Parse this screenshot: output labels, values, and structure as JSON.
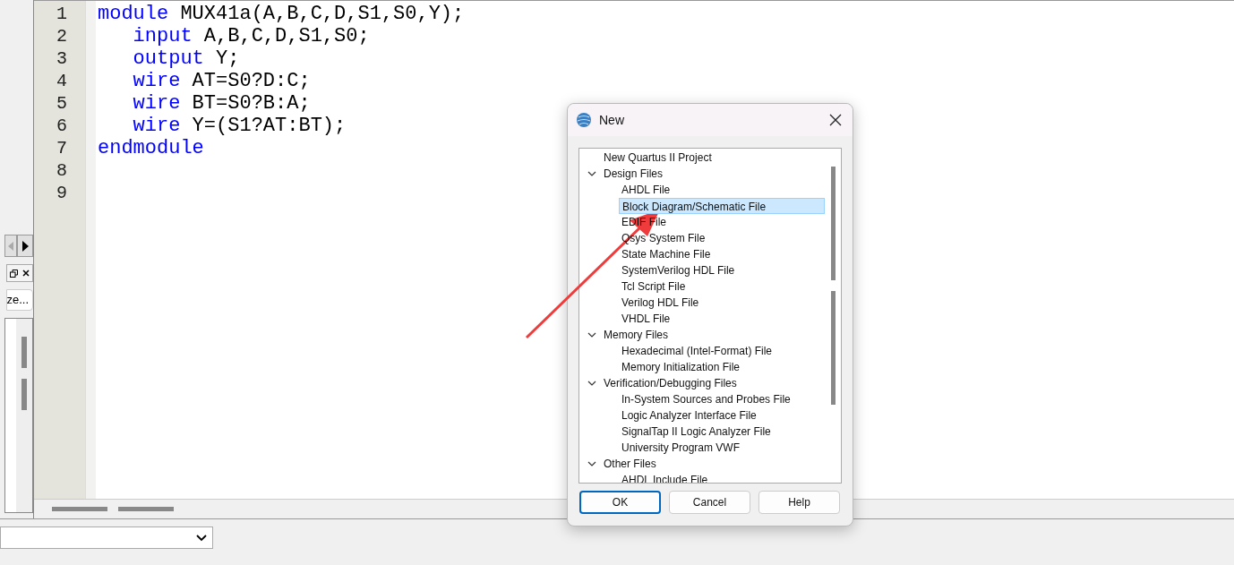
{
  "side_panel": {
    "button_text": "ze..."
  },
  "editor": {
    "lines": [
      {
        "number": "1",
        "tokens": [
          {
            "text": "module",
            "kind": "keyword"
          },
          {
            "text": " MUX41a(A,B,C,D,S1,S0,Y);",
            "kind": "plain"
          }
        ]
      },
      {
        "number": "2",
        "tokens": [
          {
            "text": "   input",
            "kind": "keyword"
          },
          {
            "text": " A,B,C,D,S1,S0;",
            "kind": "plain"
          }
        ]
      },
      {
        "number": "3",
        "tokens": [
          {
            "text": "   output",
            "kind": "keyword"
          },
          {
            "text": " Y;",
            "kind": "plain"
          }
        ]
      },
      {
        "number": "4",
        "tokens": [
          {
            "text": "   wire",
            "kind": "keyword"
          },
          {
            "text": " AT=S0?D:C;",
            "kind": "plain"
          }
        ]
      },
      {
        "number": "5",
        "tokens": [
          {
            "text": "   wire",
            "kind": "keyword"
          },
          {
            "text": " BT=S0?B:A;",
            "kind": "plain"
          }
        ]
      },
      {
        "number": "6",
        "tokens": [
          {
            "text": "   wire",
            "kind": "keyword"
          },
          {
            "text": " Y=(S1?AT:BT);",
            "kind": "plain"
          }
        ]
      },
      {
        "number": "7",
        "tokens": [
          {
            "text": "endmodule",
            "kind": "keyword"
          }
        ]
      },
      {
        "number": "8"
      },
      {
        "number": "9"
      }
    ]
  },
  "dialog": {
    "title": "New",
    "items": [
      {
        "label": "New Quartus II Project",
        "selected": false
      },
      {
        "label": "Design Files",
        "expanded": true,
        "selected": false,
        "children": [
          {
            "label": "AHDL File",
            "selected": false
          },
          {
            "label": "Block Diagram/Schematic File",
            "selected": true
          },
          {
            "label": "EDIF File",
            "selected": false
          },
          {
            "label": "Qsys System File",
            "selected": false
          },
          {
            "label": "State Machine File",
            "selected": false
          },
          {
            "label": "SystemVerilog HDL File",
            "selected": false
          },
          {
            "label": "Tcl Script File",
            "selected": false
          },
          {
            "label": "Verilog HDL File",
            "selected": false
          },
          {
            "label": "VHDL File",
            "selected": false
          }
        ]
      },
      {
        "label": "Memory Files",
        "expanded": true,
        "selected": false,
        "children": [
          {
            "label": "Hexadecimal (Intel-Format) File",
            "selected": false
          },
          {
            "label": "Memory Initialization File",
            "selected": false
          }
        ]
      },
      {
        "label": "Verification/Debugging Files",
        "expanded": true,
        "selected": false,
        "children": [
          {
            "label": "In-System Sources and Probes File",
            "selected": false
          },
          {
            "label": "Logic Analyzer Interface File",
            "selected": false
          },
          {
            "label": "SignalTap II Logic Analyzer File",
            "selected": false
          },
          {
            "label": "University Program VWF",
            "selected": false
          }
        ]
      },
      {
        "label": "Other Files",
        "expanded": true,
        "selected": false,
        "children": [
          {
            "label": "AHDL Include File",
            "selected": false
          }
        ]
      }
    ],
    "buttons": [
      {
        "label": "OK",
        "default": true
      },
      {
        "label": "Cancel",
        "default": false
      },
      {
        "label": "Help",
        "default": false
      }
    ]
  }
}
